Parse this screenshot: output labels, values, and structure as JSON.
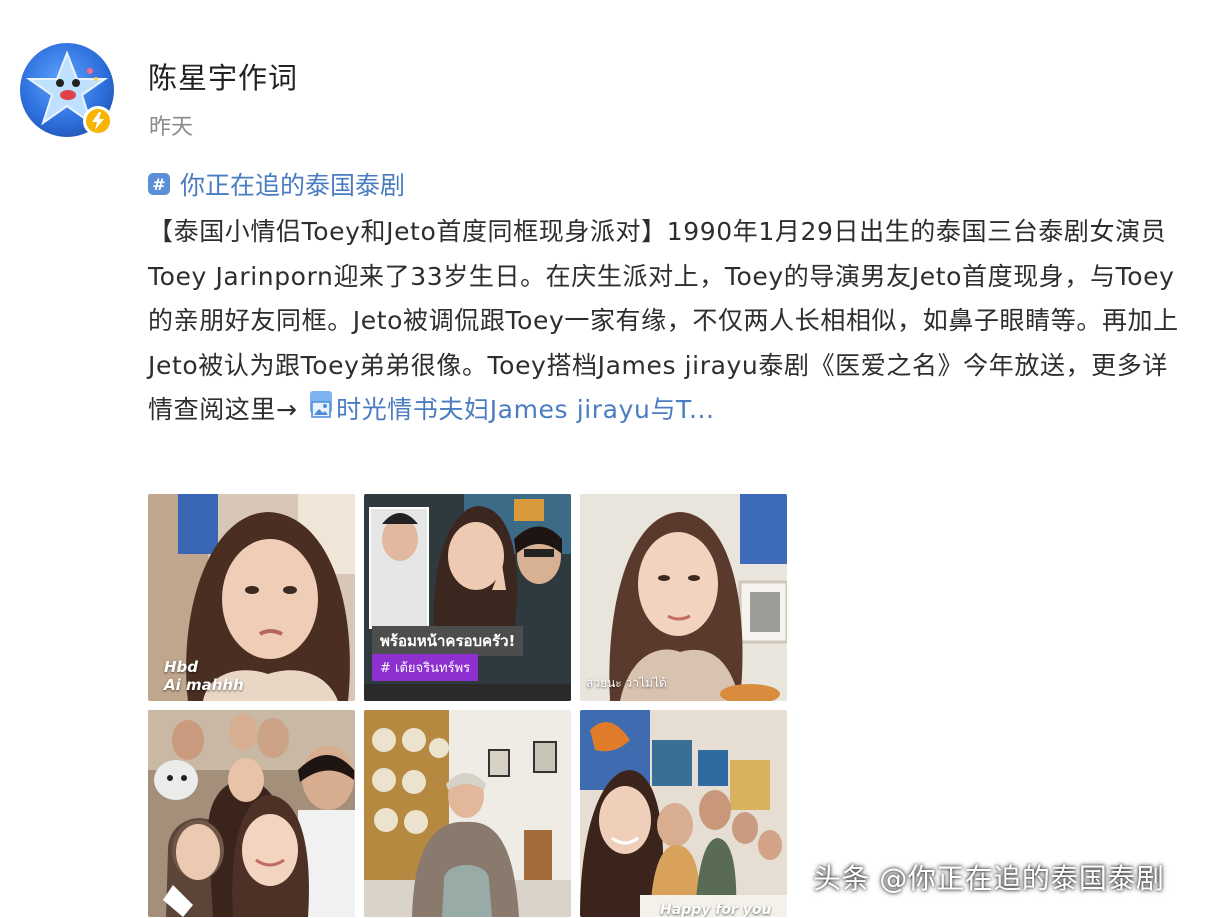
{
  "author": {
    "name": "陈星宇作词",
    "time": "昨天",
    "avatar_icon": "star-mascot-avatar",
    "badge_icon": "lightning-verified-icon"
  },
  "topic": {
    "icon": "hashtag-icon",
    "label": "你正在追的泰国泰剧"
  },
  "post": {
    "text": "【泰国小情侣Toey和Jeto首度同框现身派对】1990年1月29日出生的泰国三台泰剧女演员Toey  Jarinporn迎来了33岁生日。在庆生派对上，Toey的导演男友Jeto首度现身，与Toey的亲朋好友同框。Jeto被调侃跟Toey一家有缘，不仅两人长相相似，如鼻子眼睛等。再加上Jeto被认为跟Toey弟弟很像。Toey搭档James jirayu泰剧《医爱之名》今年放送，更多详情查阅这里→ ",
    "link_icon": "image-link-icon",
    "link_text": "时光情书夫妇James jirayu与T..."
  },
  "photos": [
    {
      "caption_line1": "Hbd",
      "caption_line2": "Ai mahhh"
    },
    {
      "caption_banner": "พร้อมหน้าครอบครัว!",
      "caption_tag": "# เต้ยจรินทร์พร"
    },
    {
      "caption_line1": "สวยนะ ว่าไม่ได้"
    },
    {},
    {},
    {
      "caption_line1": "Happy for you"
    }
  ],
  "watermark": "头条 @你正在追的泰国泰剧",
  "colors": {
    "link": "#4a7cc2",
    "text": "#2e2e2e",
    "muted": "#8a8a8a",
    "badge": "#f7b500",
    "purple_banner": "#8e2fd0"
  }
}
